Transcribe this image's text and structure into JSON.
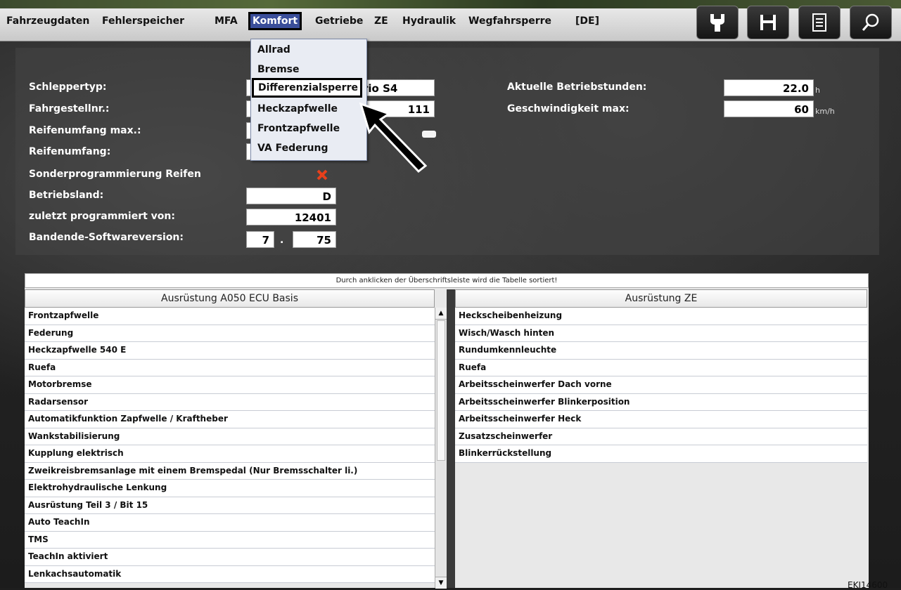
{
  "menu": {
    "items": [
      "Fahrzeugdaten",
      "Fehlerspeicher",
      "MFA",
      "Komfort",
      "Getriebe",
      "ZE",
      "Hydraulik",
      "Wegfahrsperre",
      "[DE]"
    ],
    "active": "Komfort"
  },
  "toolbar": {
    "icons": [
      "wrench-icon",
      "save-icon",
      "document-icon",
      "search-icon"
    ]
  },
  "dropdown": {
    "items": [
      "Allrad",
      "Bremse",
      "Differenzialsperre",
      "Heckzapfwelle",
      "Frontzapfwelle",
      "VA Federung"
    ],
    "highlighted": "Differenzialsperre"
  },
  "vehicle": {
    "labels": {
      "schleppertyp": "Schleppertyp:",
      "fahrgestellnr": "Fahrgestellnr.:",
      "reifenumfang_max": "Reifenumfang max.:",
      "reifenumfang": "Reifenumfang:",
      "sonderprogrammierung": "Sonderprogrammierung Reifen",
      "betriebsland": "Betriebsland:",
      "zuletzt": "zuletzt programmiert von:",
      "bandende": "Bandende-Softwareversion:",
      "betriebsstunden": "Aktuelle Betriebstunden:",
      "geschwindigkeit": "Geschwindigkeit max:"
    },
    "values": {
      "schleppertyp": "rio S4",
      "fahrgestellnr": "111",
      "betriebsland": "D",
      "zuletzt": "12401",
      "version_major": "7",
      "version_sep": ".",
      "version_minor": "75",
      "betriebsstunden": "22.0",
      "betriebsstunden_unit": "h",
      "geschwindigkeit": "60",
      "geschwindigkeit_unit": "km/h"
    }
  },
  "table": {
    "notice": "Durch anklicken der Überschriftsleiste  wird die Tabelle sortiert!",
    "left_header": "Ausrüstung A050 ECU Basis",
    "right_header": "Ausrüstung ZE",
    "left_rows": [
      "Frontzapfwelle",
      "Federung",
      "Heckzapfwelle 540 E",
      "Ruefa",
      "Motorbremse",
      "Radarsensor",
      "Automatikfunktion Zapfwelle / Kraftheber",
      "Wankstabilisierung",
      "Kupplung elektrisch",
      "Zweikreisbremsanlage mit einem Bremspedal (Nur Bremsschalter li.)",
      "Elektrohydraulische Lenkung",
      "Ausrüstung Teil 3 / Bit 15",
      "Auto TeachIn",
      "TMS",
      "TeachIn aktiviert",
      "Lenkachsautomatik"
    ],
    "right_rows": [
      "Heckscheibenheizung",
      "Wisch/Wasch hinten",
      "Rundumkennleuchte",
      "Ruefa",
      "Arbeitsscheinwerfer Dach vorne",
      "Arbeitsscheinwerfer Blinkerposition",
      "Arbeitsscheinwerfer Heck",
      "Zusatzscheinwerfer",
      "Blinkerrückstellung"
    ]
  },
  "watermark": "EKI14600"
}
